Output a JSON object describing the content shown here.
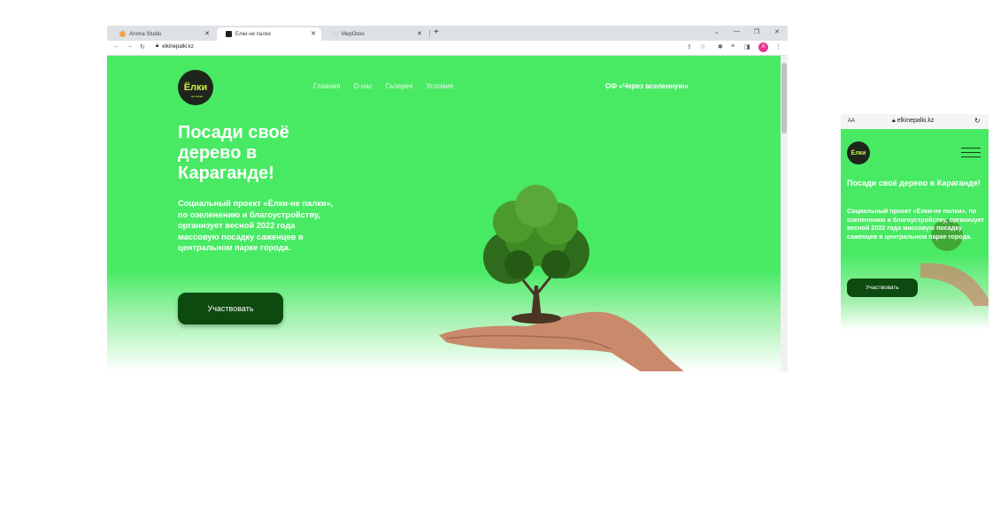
{
  "browser": {
    "tabs": [
      {
        "title": "Aroma Studio"
      },
      {
        "title": "Елки-не палки"
      },
      {
        "title": "МирОкон"
      }
    ],
    "address": "elkinepalki.kz",
    "profile_initial": "A"
  },
  "site": {
    "logo_text": "Ёлки",
    "logo_subtext": "не палки",
    "nav": [
      "Главная",
      "О нас",
      "Галерея",
      "Условия"
    ],
    "org": "ОФ «Через вселенную»",
    "hero_title": "Посади своё дерево в Караганде!",
    "hero_desc": "Социальный проект «Ёлки-не палки», по озеленению и благоустройству, организует весной 2022 года массовую посадку саженцев в центральном парке города.",
    "cta": "Участвовать"
  },
  "mobile": {
    "aa": "AA",
    "address": "elkinepalki.kz"
  },
  "colors": {
    "hero_green": "#48ea64",
    "button_dark": "#0c4a0f",
    "logo_bg": "#1f241c",
    "logo_accent": "#c8f04a"
  }
}
